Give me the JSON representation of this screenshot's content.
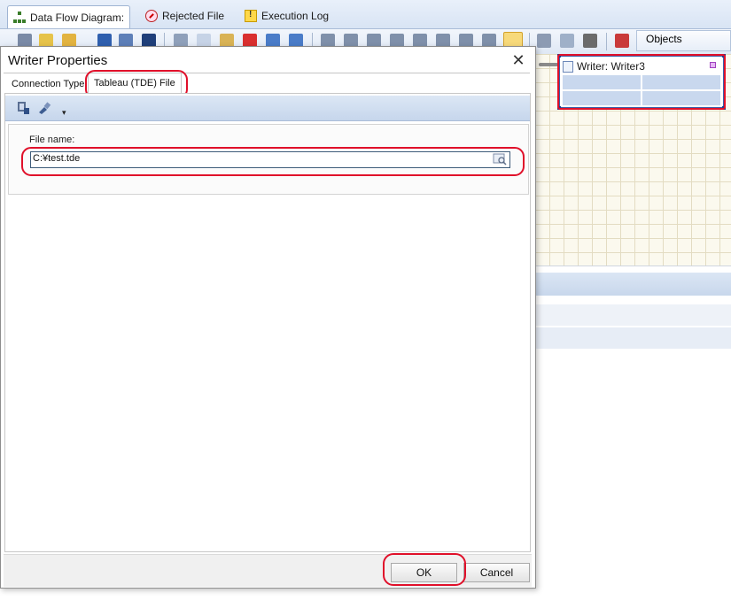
{
  "document_tabs": [
    {
      "label": "Data Flow Diagram:",
      "icon": "diagram-icon"
    },
    {
      "label": "Rejected File",
      "icon": "rejected-icon"
    },
    {
      "label": "Execution Log",
      "icon": "warning-icon"
    }
  ],
  "objects_panel": {
    "label": "Objects"
  },
  "canvas": {
    "writer_node": {
      "title": "Writer: Writer3"
    }
  },
  "dialog": {
    "title": "Writer Properties",
    "close_glyph": "✕",
    "tabs": [
      "Connection Type",
      "Tableau (TDE) File"
    ],
    "selected_tab": "Tableau (TDE) File",
    "file_name_label": "File name:",
    "file_name_value": "C:¥test.tde",
    "buttons": {
      "ok": "OK",
      "cancel": "Cancel"
    }
  },
  "colors": {
    "annotation": "#e0102a",
    "canvas_bg": "#fbf9ee",
    "node_border": "#3b5ea8",
    "selected_toolbar_button": "#f7d97a"
  }
}
